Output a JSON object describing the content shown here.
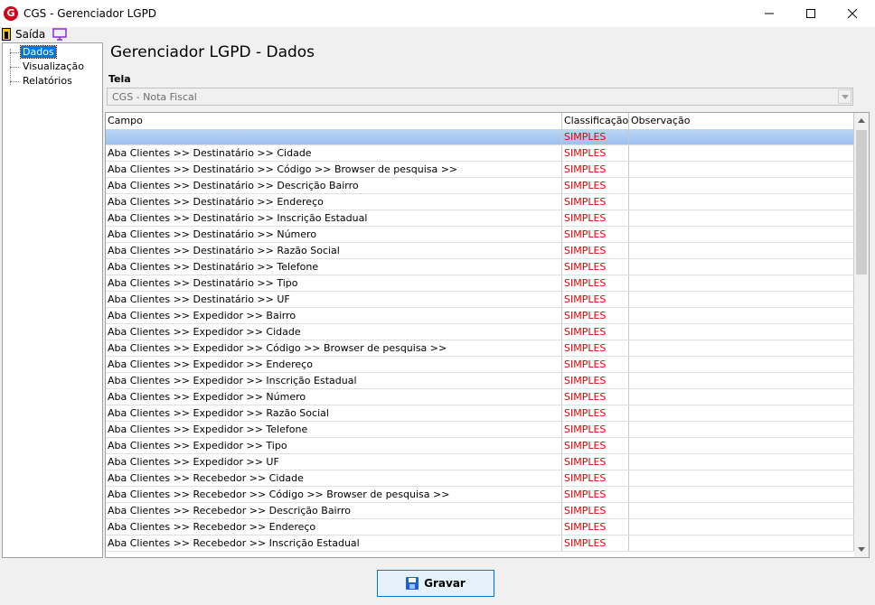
{
  "window": {
    "title": "CGS - Gerenciador LGPD",
    "app_icon_letter": "G",
    "buttons": {
      "minimize": "—",
      "maximize": "☐",
      "close": "✕"
    }
  },
  "toolbar": {
    "exit_label": "Saída",
    "exit_icon": "door-exit-icon",
    "monitor_icon": "monitor-icon"
  },
  "tree": {
    "items": [
      {
        "label": "Dados",
        "selected": true
      },
      {
        "label": "Visualização",
        "selected": false
      },
      {
        "label": "Relatórios",
        "selected": false
      }
    ]
  },
  "main": {
    "title": "Gerenciador LGPD - Dados",
    "tela_label": "Tela",
    "tela_value": "CGS - Nota Fiscal"
  },
  "grid": {
    "columns": [
      "Campo",
      "Classificação",
      "Observação"
    ],
    "rows": [
      {
        "campo": "",
        "classificacao": "SIMPLES",
        "observacao": "",
        "selected": true
      },
      {
        "campo": "Aba Clientes >> Destinatário >> Cidade",
        "classificacao": "SIMPLES",
        "observacao": ""
      },
      {
        "campo": "Aba Clientes >> Destinatário >> Código >> Browser de pesquisa >>",
        "classificacao": "SIMPLES",
        "observacao": ""
      },
      {
        "campo": "Aba Clientes >> Destinatário >> Descrição Bairro",
        "classificacao": "SIMPLES",
        "observacao": ""
      },
      {
        "campo": "Aba Clientes >> Destinatário >> Endereço",
        "classificacao": "SIMPLES",
        "observacao": ""
      },
      {
        "campo": "Aba Clientes >> Destinatário >> Inscrição Estadual",
        "classificacao": "SIMPLES",
        "observacao": ""
      },
      {
        "campo": "Aba Clientes >> Destinatário >> Número",
        "classificacao": "SIMPLES",
        "observacao": ""
      },
      {
        "campo": "Aba Clientes >> Destinatário >> Razão Social",
        "classificacao": "SIMPLES",
        "observacao": ""
      },
      {
        "campo": "Aba Clientes >> Destinatário >> Telefone",
        "classificacao": "SIMPLES",
        "observacao": ""
      },
      {
        "campo": "Aba Clientes >> Destinatário >> Tipo",
        "classificacao": "SIMPLES",
        "observacao": ""
      },
      {
        "campo": "Aba Clientes >> Destinatário >> UF",
        "classificacao": "SIMPLES",
        "observacao": ""
      },
      {
        "campo": "Aba Clientes >> Expedidor >> Bairro",
        "classificacao": "SIMPLES",
        "observacao": ""
      },
      {
        "campo": "Aba Clientes >> Expedidor >> Cidade",
        "classificacao": "SIMPLES",
        "observacao": ""
      },
      {
        "campo": "Aba Clientes >> Expedidor >> Código >> Browser de pesquisa >>",
        "classificacao": "SIMPLES",
        "observacao": ""
      },
      {
        "campo": "Aba Clientes >> Expedidor >> Endereço",
        "classificacao": "SIMPLES",
        "observacao": ""
      },
      {
        "campo": "Aba Clientes >> Expedidor >> Inscrição Estadual",
        "classificacao": "SIMPLES",
        "observacao": ""
      },
      {
        "campo": "Aba Clientes >> Expedidor >> Número",
        "classificacao": "SIMPLES",
        "observacao": ""
      },
      {
        "campo": "Aba Clientes >> Expedidor >> Razão Social",
        "classificacao": "SIMPLES",
        "observacao": ""
      },
      {
        "campo": "Aba Clientes >> Expedidor >> Telefone",
        "classificacao": "SIMPLES",
        "observacao": ""
      },
      {
        "campo": "Aba Clientes >> Expedidor >> Tipo",
        "classificacao": "SIMPLES",
        "observacao": ""
      },
      {
        "campo": "Aba Clientes >> Expedidor >> UF",
        "classificacao": "SIMPLES",
        "observacao": ""
      },
      {
        "campo": "Aba Clientes >> Recebedor >> Cidade",
        "classificacao": "SIMPLES",
        "observacao": ""
      },
      {
        "campo": "Aba Clientes >> Recebedor >> Código >> Browser de pesquisa >>",
        "classificacao": "SIMPLES",
        "observacao": ""
      },
      {
        "campo": "Aba Clientes >> Recebedor >> Descrição Bairro",
        "classificacao": "SIMPLES",
        "observacao": ""
      },
      {
        "campo": "Aba Clientes >> Recebedor >> Endereço",
        "classificacao": "SIMPLES",
        "observacao": ""
      },
      {
        "campo": "Aba Clientes >> Recebedor >> Inscrição Estadual",
        "classificacao": "SIMPLES",
        "observacao": ""
      }
    ]
  },
  "footer": {
    "save_label": "Gravar",
    "save_icon": "floppy-disk-icon"
  },
  "colors": {
    "classification_text": "#e60000",
    "selection": "#0078d7",
    "row_selected": "#a8c8f0"
  }
}
